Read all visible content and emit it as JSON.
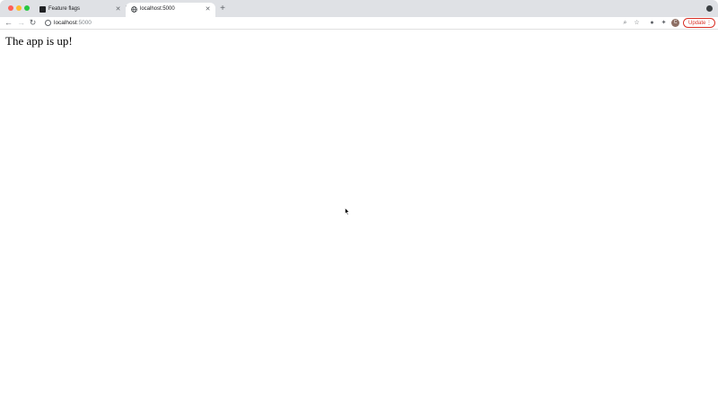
{
  "browser": {
    "tabs": [
      {
        "label": "Feature flags",
        "active": false,
        "icon": "flag-favicon-icon"
      },
      {
        "label": "localhost:5000",
        "active": true,
        "icon": "globe-icon"
      }
    ],
    "new_tab_label": "+",
    "url": {
      "host": "localhost",
      "port": ":5000"
    },
    "update_label": "Update",
    "avatar_initial": "C",
    "colors": {
      "tabstrip": "#dfe1e5",
      "update_accent": "#d93025"
    }
  },
  "page": {
    "text": "The app is up!"
  }
}
